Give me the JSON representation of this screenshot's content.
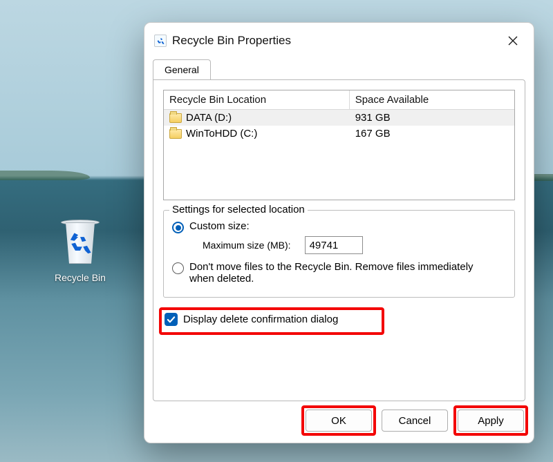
{
  "desktop": {
    "icon_label": "Recycle Bin"
  },
  "dialog": {
    "title": "Recycle Bin Properties",
    "tab_general": "General",
    "table_head_location": "Recycle Bin Location",
    "table_head_space": "Space Available",
    "rows": [
      {
        "name": "DATA (D:)",
        "space": "931 GB"
      },
      {
        "name": "WinToHDD (C:)",
        "space": "167 GB"
      }
    ],
    "fieldset_legend": "Settings for selected location",
    "radio_custom": "Custom size:",
    "max_label": "Maximum size (MB):",
    "max_value": "49741",
    "radio_noremove": "Don't move files to the Recycle Bin. Remove files immediately when deleted.",
    "confirm_label": "Display delete confirmation dialog",
    "btn_ok": "OK",
    "btn_cancel": "Cancel",
    "btn_apply": "Apply"
  }
}
